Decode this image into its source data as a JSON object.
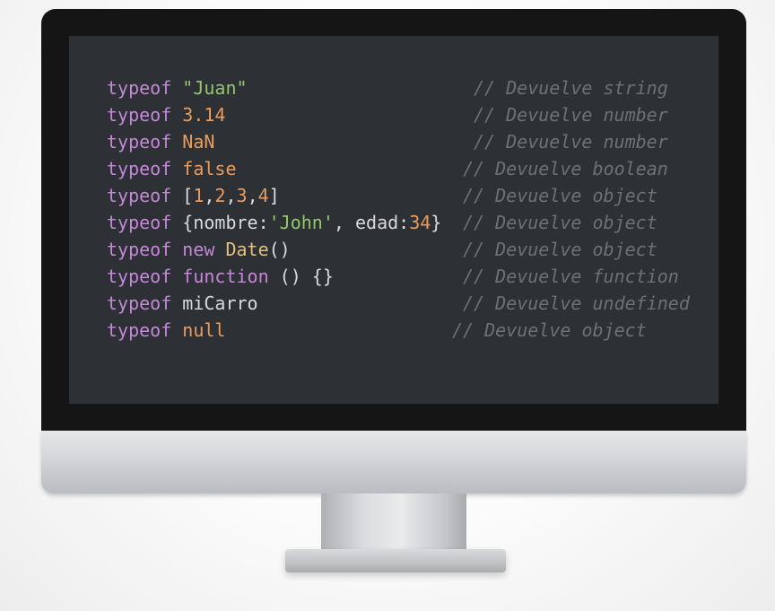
{
  "code_lines": [
    {
      "tokens": [
        {
          "text": "typeof",
          "kind": "keyword"
        },
        {
          "text": " ",
          "kind": "punct"
        },
        {
          "text": "\"Juan\"",
          "kind": "string"
        }
      ],
      "comment": "// Devuelve string"
    },
    {
      "tokens": [
        {
          "text": "typeof",
          "kind": "keyword"
        },
        {
          "text": " ",
          "kind": "punct"
        },
        {
          "text": "3.14",
          "kind": "number"
        }
      ],
      "comment": "// Devuelve number"
    },
    {
      "tokens": [
        {
          "text": "typeof",
          "kind": "keyword"
        },
        {
          "text": " ",
          "kind": "punct"
        },
        {
          "text": "NaN",
          "kind": "number"
        }
      ],
      "comment": "// Devuelve number"
    },
    {
      "tokens": [
        {
          "text": "typeof",
          "kind": "keyword"
        },
        {
          "text": " ",
          "kind": "punct"
        },
        {
          "text": "false",
          "kind": "number"
        }
      ],
      "comment": "// Devuelve boolean"
    },
    {
      "tokens": [
        {
          "text": "typeof",
          "kind": "keyword"
        },
        {
          "text": " [",
          "kind": "punct"
        },
        {
          "text": "1",
          "kind": "number"
        },
        {
          "text": ",",
          "kind": "punct"
        },
        {
          "text": "2",
          "kind": "number"
        },
        {
          "text": ",",
          "kind": "punct"
        },
        {
          "text": "3",
          "kind": "number"
        },
        {
          "text": ",",
          "kind": "punct"
        },
        {
          "text": "4",
          "kind": "number"
        },
        {
          "text": "]",
          "kind": "punct"
        }
      ],
      "comment": "// Devuelve object"
    },
    {
      "tokens": [
        {
          "text": "typeof",
          "kind": "keyword"
        },
        {
          "text": " {",
          "kind": "punct"
        },
        {
          "text": "nombre:",
          "kind": "prop"
        },
        {
          "text": "'John'",
          "kind": "string"
        },
        {
          "text": ", ",
          "kind": "punct"
        },
        {
          "text": "edad:",
          "kind": "prop"
        },
        {
          "text": "34",
          "kind": "number"
        },
        {
          "text": "}",
          "kind": "punct"
        }
      ],
      "comment": "// Devuelve object"
    },
    {
      "tokens": [
        {
          "text": "typeof",
          "kind": "keyword"
        },
        {
          "text": " ",
          "kind": "punct"
        },
        {
          "text": "new",
          "kind": "keyword"
        },
        {
          "text": " ",
          "kind": "punct"
        },
        {
          "text": "Date",
          "kind": "class"
        },
        {
          "text": "()",
          "kind": "punct"
        }
      ],
      "comment": "// Devuelve object"
    },
    {
      "tokens": [
        {
          "text": "typeof",
          "kind": "keyword"
        },
        {
          "text": " ",
          "kind": "punct"
        },
        {
          "text": "function",
          "kind": "keyword"
        },
        {
          "text": " () {}",
          "kind": "punct"
        }
      ],
      "comment": "// Devuelve function"
    },
    {
      "tokens": [
        {
          "text": "typeof",
          "kind": "keyword"
        },
        {
          "text": " miCarro",
          "kind": "punct"
        }
      ],
      "comment": "// Devuelve undefined"
    },
    {
      "tokens": [
        {
          "text": "typeof",
          "kind": "keyword"
        },
        {
          "text": " ",
          "kind": "punct"
        },
        {
          "text": "null",
          "kind": "number"
        }
      ],
      "comment": "// Devuelve object"
    }
  ],
  "colors": {
    "screen_bg": "#2d3135",
    "keyword": "#c587d7",
    "string": "#93c76b",
    "number": "#e99c5d",
    "class": "#e4c07a",
    "comment": "#6c7177",
    "text": "#d9dadc"
  }
}
